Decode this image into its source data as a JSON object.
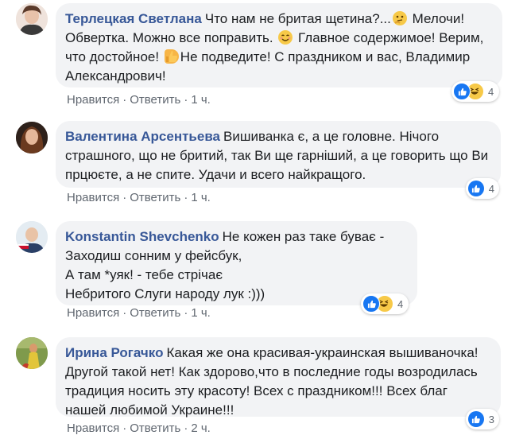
{
  "comments": [
    {
      "author": "Терлецкая Светлана",
      "text_segments": [
        "Что нам не бритая щетина?...",
        " Мелочи! Обвертка. Можно все поправить. ",
        " Главное содержимое! Верим, что достойное! ",
        "Не подведите! С праздником и вас, Владимир Александрович!"
      ],
      "emojis": [
        "thinking-face",
        "smiling-face",
        "thumbs-up"
      ],
      "reaction_count": "4",
      "reactions": [
        "like",
        "haha"
      ],
      "like_label": "Нравится",
      "reply_label": "Ответить",
      "time": "1 ч."
    },
    {
      "author": "Валентина Арсентьева",
      "text": "Вишиванка є, а це головне. Нічого страшного, що не бритий, так Ви ще гарніший, а це говорить що Ви прцюєте, а не спите. Удачи и всего найкращого.",
      "reaction_count": "4",
      "reactions": [
        "like"
      ],
      "like_label": "Нравится",
      "reply_label": "Ответить",
      "time": "1 ч."
    },
    {
      "author": "Konstantin Shevchenko",
      "lines": [
        "Не кожен раз таке буває -",
        "Заходиш сонним у фейсбук,",
        "А там *уяк! - тебе стрічає",
        "Небритого Слуги народу лук :)))"
      ],
      "reaction_count": "4",
      "reactions": [
        "like",
        "haha"
      ],
      "like_label": "Нравится",
      "reply_label": "Ответить",
      "time": "1 ч."
    },
    {
      "author": "Ирина Рогачко",
      "text": "Какая же она красивая-украинская вышиваночка! Другой такой нет! Как здорово,что в последние годы возродилась традиция носить эту красоту! Всех с праздником!!! Всех благ нашей любимой Украине!!!",
      "reaction_count": "3",
      "reactions": [
        "like"
      ],
      "like_label": "Нравится",
      "reply_label": "Ответить",
      "time": "2 ч."
    }
  ],
  "separator": "·",
  "colors": {
    "author": "#385898",
    "bubble": "#f2f3f5",
    "like_blue": "#1877f2",
    "meta_gray": "#606770"
  }
}
